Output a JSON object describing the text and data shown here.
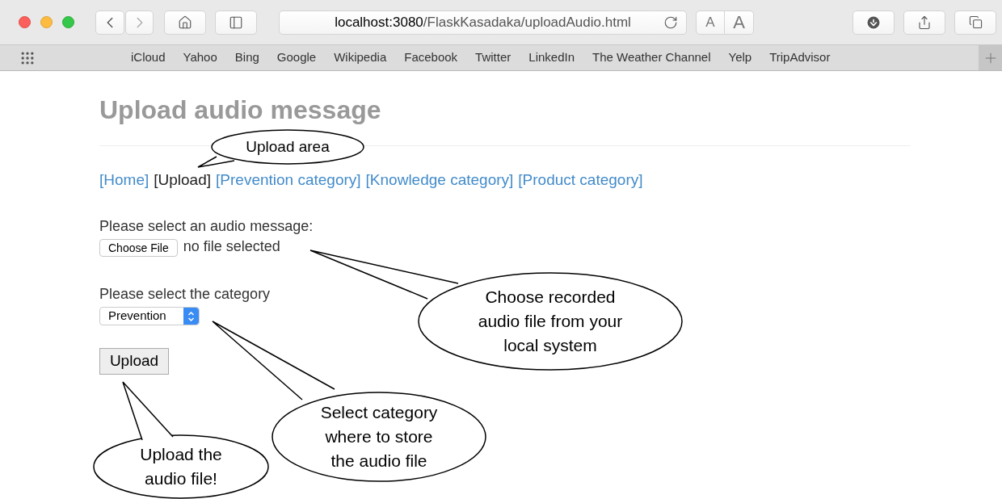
{
  "browser": {
    "url_host": "localhost:3080",
    "url_path": "/FlaskKasadaka/uploadAudio.html",
    "font_buttons": [
      "A",
      "A"
    ],
    "bookmarks": [
      "iCloud",
      "Yahoo",
      "Bing",
      "Google",
      "Wikipedia",
      "Facebook",
      "Twitter",
      "LinkedIn",
      "The Weather Channel",
      "Yelp",
      "TripAdvisor"
    ]
  },
  "page": {
    "title": "Upload audio message",
    "nav": [
      {
        "label": "[Home]",
        "selected": false
      },
      {
        "label": "[Upload]",
        "selected": true
      },
      {
        "label": "[Prevention category]",
        "selected": false
      },
      {
        "label": "[Knowledge category]",
        "selected": false
      },
      {
        "label": "[Product category]",
        "selected": false
      }
    ],
    "file_label": "Please select an audio message:",
    "file_button": "Choose File",
    "file_status": "no file selected",
    "category_label": "Please select the category",
    "category_value": "Prevention",
    "submit": "Upload"
  },
  "callouts": [
    {
      "lines": [
        "Upload area"
      ]
    },
    {
      "lines": [
        "Choose recorded",
        "audio file from your",
        "local system"
      ]
    },
    {
      "lines": [
        "Select category",
        "where to store",
        "the audio file"
      ]
    },
    {
      "lines": [
        "Upload the",
        "audio file!"
      ]
    }
  ]
}
